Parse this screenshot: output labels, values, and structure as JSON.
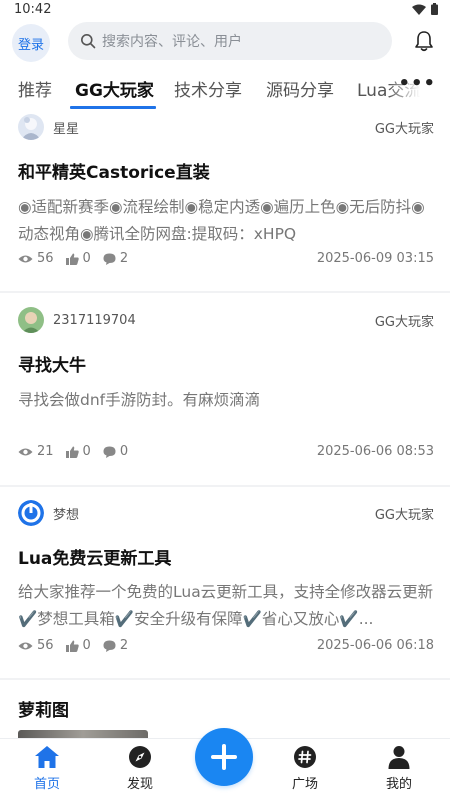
{
  "status_bar": {
    "time": "10:42"
  },
  "header": {
    "login_label": "登录",
    "search_placeholder": "搜索内容、评论、用户"
  },
  "tabs": [
    {
      "label": "推荐",
      "active": false
    },
    {
      "label": "GG大玩家",
      "active": true
    },
    {
      "label": "技术分享",
      "active": false
    },
    {
      "label": "源码分享",
      "active": false
    },
    {
      "label": "Lua交流",
      "active": false
    }
  ],
  "posts": [
    {
      "author": "星星",
      "category": "GG大玩家",
      "title": "和平精英Castorice直装",
      "summary": "◉适配新赛季◉流程绘制◉稳定内透◉遍历上色◉无后防抖◉动态视角◉腾讯全防网盘:提取码：xHPQ",
      "views": "56",
      "likes": "0",
      "comments": "2",
      "date": "2025-06-09 03:15"
    },
    {
      "author": "2317119704",
      "category": "GG大玩家",
      "title": "寻找大牛",
      "summary": "寻找会做dnf手游防封。有麻烦滴滴",
      "views": "21",
      "likes": "0",
      "comments": "0",
      "date": "2025-06-06 08:53"
    },
    {
      "author": "梦想",
      "category": "GG大玩家",
      "title": "Lua免费云更新工具",
      "summary": "给大家推荐一个免费的Lua云更新工具，支持全修改器云更新✔️梦想工具箱✔️安全升级有保障✔️省心又放心✔️...",
      "views": "56",
      "likes": "0",
      "comments": "2",
      "date": "2025-06-06 06:18"
    },
    {
      "title": "萝莉图"
    }
  ],
  "bottom_nav": {
    "home": "首页",
    "discover": "发现",
    "plaza": "广场",
    "mine": "我的"
  },
  "colors": {
    "accent": "#1f73e8",
    "fab": "#1a86f2"
  }
}
